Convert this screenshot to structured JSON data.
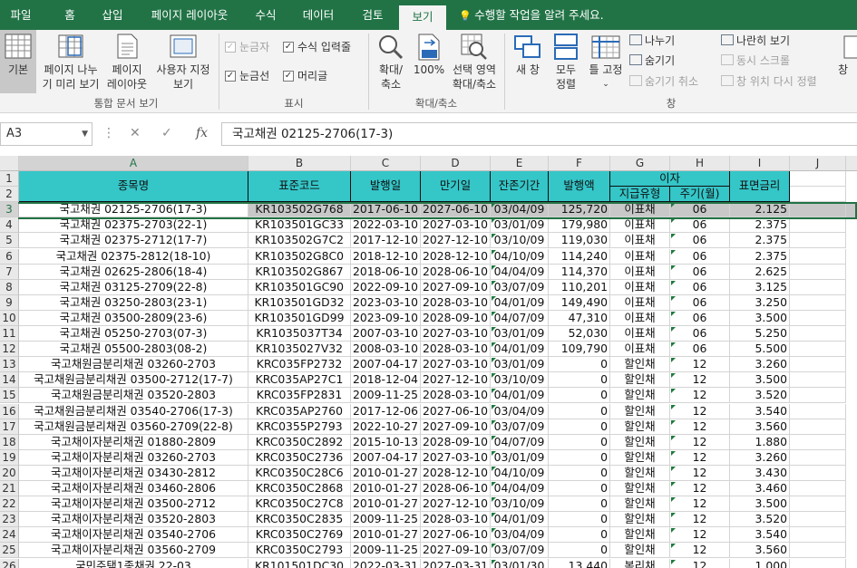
{
  "ribbon_tabs": [
    "파일",
    "홈",
    "삽입",
    "페이지 레이아웃",
    "수식",
    "데이터",
    "검토",
    "보기"
  ],
  "active_tab": "보기",
  "tell_me": "수행할 작업을 알려 주세요.",
  "ribbon": {
    "normal": "기본",
    "page_break": [
      "페이지 나누",
      "기 미리 보기"
    ],
    "page_layout": [
      "페이지",
      "레이아웃"
    ],
    "custom_view": [
      "사용자 지정",
      "보기"
    ],
    "group_workbook_views": "통합 문서 보기",
    "ruler": "눈금자",
    "formula_bar": "수식 입력줄",
    "gridlines": "눈금선",
    "headings": "머리글",
    "group_show": "표시",
    "zoom": [
      "확대/",
      "축소"
    ],
    "zoom100": "100%",
    "zoom_selection": [
      "선택 영역",
      "확대/축소"
    ],
    "group_zoom": "확대/축소",
    "new_window": "새 창",
    "arrange_all": [
      "모두",
      "정렬"
    ],
    "freeze": "틀 고정",
    "split": "나누기",
    "hide": "숨기기",
    "unhide": "숨기기 취소",
    "side_by_side": "나란히 보기",
    "sync_scroll": "동시 스크롤",
    "reset_position": "창 위치 다시 정렬",
    "group_window": "창",
    "switch": "창"
  },
  "name_box": "A3",
  "formula": "국고채권 02125-2706(17-3)",
  "columns": [
    "A",
    "B",
    "C",
    "D",
    "E",
    "F",
    "G",
    "H",
    "I",
    "J"
  ],
  "headers": {
    "name": "종목명",
    "code": "표준코드",
    "issue": "발행일",
    "maturity": "만기일",
    "remaining": "잔존기간",
    "amount": "발행액",
    "interest": "이자",
    "pay_type": "지급유형",
    "period": "주기(월)",
    "coupon": "표면금리"
  },
  "rows": [
    [
      "국고채권 02125-2706(17-3)",
      "KR103502G768",
      "2017-06-10",
      "2027-06-10",
      "03/04/09",
      "125,720",
      "이표채",
      "06",
      "2.125"
    ],
    [
      "국고채권 02375-2703(22-1)",
      "KR103501GC33",
      "2022-03-10",
      "2027-03-10",
      "03/01/09",
      "179,980",
      "이표채",
      "06",
      "2.375"
    ],
    [
      "국고채권 02375-2712(17-7)",
      "KR103502G7C2",
      "2017-12-10",
      "2027-12-10",
      "03/10/09",
      "119,030",
      "이표채",
      "06",
      "2.375"
    ],
    [
      "국고채권 02375-2812(18-10)",
      "KR103502G8C0",
      "2018-12-10",
      "2028-12-10",
      "04/10/09",
      "114,240",
      "이표채",
      "06",
      "2.375"
    ],
    [
      "국고채권 02625-2806(18-4)",
      "KR103502G867",
      "2018-06-10",
      "2028-06-10",
      "04/04/09",
      "114,370",
      "이표채",
      "06",
      "2.625"
    ],
    [
      "국고채권 03125-2709(22-8)",
      "KR103501GC90",
      "2022-09-10",
      "2027-09-10",
      "03/07/09",
      "110,201",
      "이표채",
      "06",
      "3.125"
    ],
    [
      "국고채권 03250-2803(23-1)",
      "KR103501GD32",
      "2023-03-10",
      "2028-03-10",
      "04/01/09",
      "149,490",
      "이표채",
      "06",
      "3.250"
    ],
    [
      "국고채권 03500-2809(23-6)",
      "KR103501GD99",
      "2023-09-10",
      "2028-09-10",
      "04/07/09",
      "47,310",
      "이표채",
      "06",
      "3.500"
    ],
    [
      "국고채권 05250-2703(07-3)",
      "KR1035037T34",
      "2007-03-10",
      "2027-03-10",
      "03/01/09",
      "52,030",
      "이표채",
      "06",
      "5.250"
    ],
    [
      "국고채권 05500-2803(08-2)",
      "KR1035027V32",
      "2008-03-10",
      "2028-03-10",
      "04/01/09",
      "109,790",
      "이표채",
      "06",
      "5.500"
    ],
    [
      "국고채원금분리채권 03260-2703",
      "KRC035FP2732",
      "2007-04-17",
      "2027-03-10",
      "03/01/09",
      "0",
      "할인채",
      "12",
      "3.260"
    ],
    [
      "국고채원금분리채권 03500-2712(17-7)",
      "KRC035AP27C1",
      "2018-12-04",
      "2027-12-10",
      "03/10/09",
      "0",
      "할인채",
      "12",
      "3.500"
    ],
    [
      "국고채원금분리채권 03520-2803",
      "KRC035FP2831",
      "2009-11-25",
      "2028-03-10",
      "04/01/09",
      "0",
      "할인채",
      "12",
      "3.520"
    ],
    [
      "국고채원금분리채권 03540-2706(17-3)",
      "KRC035AP2760",
      "2017-12-06",
      "2027-06-10",
      "03/04/09",
      "0",
      "할인채",
      "12",
      "3.540"
    ],
    [
      "국고채원금분리채권 03560-2709(22-8)",
      "KRC0355P2793",
      "2022-10-27",
      "2027-09-10",
      "03/07/09",
      "0",
      "할인채",
      "12",
      "3.560"
    ],
    [
      "국고채이자분리채권 01880-2809",
      "KRC0350C2892",
      "2015-10-13",
      "2028-09-10",
      "04/07/09",
      "0",
      "할인채",
      "12",
      "1.880"
    ],
    [
      "국고채이자분리채권 03260-2703",
      "KRC0350C2736",
      "2007-04-17",
      "2027-03-10",
      "03/01/09",
      "0",
      "할인채",
      "12",
      "3.260"
    ],
    [
      "국고채이자분리채권 03430-2812",
      "KRC0350C28C6",
      "2010-01-27",
      "2028-12-10",
      "04/10/09",
      "0",
      "할인채",
      "12",
      "3.430"
    ],
    [
      "국고채이자분리채권 03460-2806",
      "KRC0350C2868",
      "2010-01-27",
      "2028-06-10",
      "04/04/09",
      "0",
      "할인채",
      "12",
      "3.460"
    ],
    [
      "국고채이자분리채권 03500-2712",
      "KRC0350C27C8",
      "2010-01-27",
      "2027-12-10",
      "03/10/09",
      "0",
      "할인채",
      "12",
      "3.500"
    ],
    [
      "국고채이자분리채권 03520-2803",
      "KRC0350C2835",
      "2009-11-25",
      "2028-03-10",
      "04/01/09",
      "0",
      "할인채",
      "12",
      "3.520"
    ],
    [
      "국고채이자분리채권 03540-2706",
      "KRC0350C2769",
      "2010-01-27",
      "2027-06-10",
      "03/04/09",
      "0",
      "할인채",
      "12",
      "3.540"
    ],
    [
      "국고채이자분리채권 03560-2709",
      "KRC0350C2793",
      "2009-11-25",
      "2027-09-10",
      "03/07/09",
      "0",
      "할인채",
      "12",
      "3.560"
    ],
    [
      "국민주택1종채권 22-03",
      "KR101501DC30",
      "2022-03-31",
      "2027-03-31",
      "03/01/30",
      "13,440",
      "복리채",
      "12",
      "1.000"
    ]
  ],
  "colors": {
    "excel_green": "#217346",
    "header_fill": "#35c6c8",
    "selection": "#c8c8c8"
  }
}
